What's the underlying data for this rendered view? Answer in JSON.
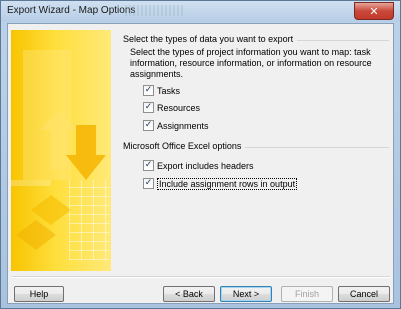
{
  "window": {
    "title": "Export Wizard - Map Options"
  },
  "data_types": {
    "header": "Select the types of data you want to export",
    "description": "Select the types of project information you want to map: task information, resource information, or information on resource assignments.",
    "options": [
      {
        "label": "Tasks",
        "checked": true
      },
      {
        "label": "Resources",
        "checked": true
      },
      {
        "label": "Assignments",
        "checked": true
      }
    ]
  },
  "excel_options": {
    "header": "Microsoft Office Excel options",
    "options": [
      {
        "label": "Export includes headers",
        "checked": true
      },
      {
        "label": "Include assignment rows in output",
        "checked": true
      }
    ]
  },
  "buttons": {
    "help": "Help",
    "back": "< Back",
    "next": "Next >",
    "finish": "Finish",
    "cancel": "Cancel"
  },
  "icons": {
    "close": "close-icon",
    "check": "checkmark-icon"
  },
  "colors": {
    "side_art": "#f7c400",
    "close_button": "#c9483a"
  }
}
